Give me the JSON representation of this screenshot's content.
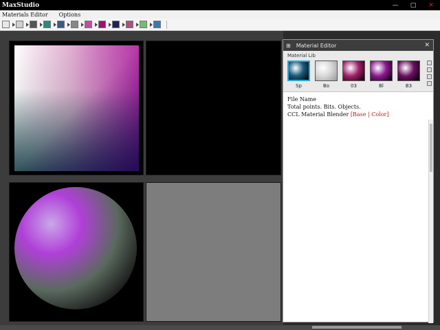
{
  "window": {
    "title": "MaxStudio",
    "controls": {
      "minimize": "—",
      "maximize": "□",
      "close": "✕"
    }
  },
  "menu": {
    "items": [
      "Materials Editor",
      "Options"
    ]
  },
  "toolbar": {
    "button_colors": [
      "#e8e8e8",
      "#d0d0d0",
      "#555555",
      "#2c8a7a",
      "#3a5a8a",
      "#888888",
      "#c050a0",
      "#a01070",
      "#202060",
      "#b05080",
      "#70c070",
      "#3a7ab0"
    ]
  },
  "viewports": {
    "names": [
      "color-gradient-view",
      "black-view",
      "sphere-view",
      "grey-view"
    ]
  },
  "panel": {
    "title": "Material Editor",
    "label": "Material Lib",
    "close": "✕",
    "swatches": [
      {
        "caption": "Sp",
        "colors": [
          "#ffffff",
          "#1c5c7c",
          "#000000"
        ]
      },
      {
        "caption": "Bo",
        "colors": [
          "#ffffff",
          "#d8d8d8",
          "#999999"
        ]
      },
      {
        "caption": "03",
        "colors": [
          "#ffffff",
          "#a0206a",
          "#000000"
        ]
      },
      {
        "caption": "Bl",
        "colors": [
          "#ffffff",
          "#8a1890",
          "#000000"
        ]
      },
      {
        "caption": "B3",
        "colors": [
          "#ffffff",
          "#6a1060",
          "#000000"
        ]
      }
    ],
    "info": {
      "line1": "File Name",
      "line2": "Total points. Bits. Objects.",
      "line3_prefix": "CCL Material Blender",
      "line3_red": "[Base | Color]"
    }
  }
}
